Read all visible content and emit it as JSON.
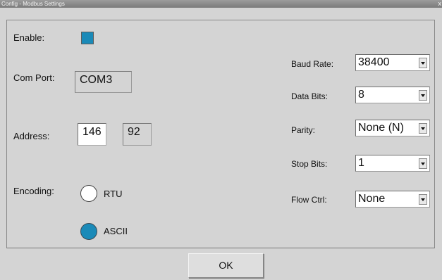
{
  "window": {
    "title": "Config - Modbus Settings",
    "close_glyph": "x"
  },
  "enable": {
    "label": "Enable:",
    "checked": true,
    "color": "#1a8ab8"
  },
  "com_port": {
    "label": "Com Port:",
    "value": "COM3"
  },
  "address": {
    "label": "Address:",
    "value": "146",
    "readonly_value": "92"
  },
  "encoding": {
    "label": "Encoding:",
    "options": [
      {
        "label": "RTU",
        "selected": false
      },
      {
        "label": "ASCII",
        "selected": true
      }
    ]
  },
  "settings": {
    "baud_rate": {
      "label": "Baud Rate:",
      "value": "38400"
    },
    "data_bits": {
      "label": "Data Bits:",
      "value": "8"
    },
    "parity": {
      "label": "Parity:",
      "value": "None (N)"
    },
    "stop_bits": {
      "label": "Stop Bits:",
      "value": "1"
    },
    "flow_ctrl": {
      "label": "Flow Ctrl:",
      "value": "None"
    }
  },
  "ok_label": "OK"
}
